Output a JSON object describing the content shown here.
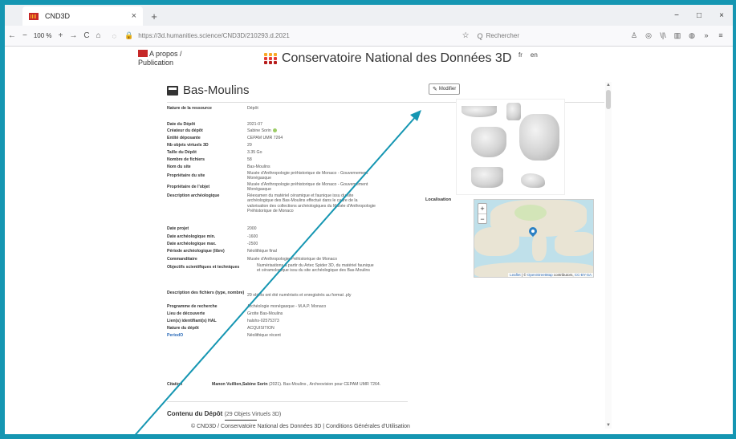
{
  "browser": {
    "tab_title": "CND3D",
    "tab_close": "×",
    "new_tab": "+",
    "window_controls": [
      "−",
      "□",
      "×"
    ],
    "back": "←",
    "forward": "→",
    "zoom_out": "−",
    "zoom_level": "100 %",
    "zoom_in": "+",
    "reload": "C",
    "home": "⌂",
    "shield": "◌",
    "lock": "🔒",
    "url": "https://3d.humanities.science/CND3D/210293.d.2021",
    "bookmark_star": "☆",
    "search_icon": "Q",
    "search_placeholder": "Rechercher",
    "toolbar_icons": [
      "♙",
      "◎",
      "\\|\\",
      "▥",
      "◍",
      "»",
      "≡"
    ]
  },
  "header": {
    "apropos": "A propos /",
    "publication": "Publication",
    "site_title": "Conservatoire National des Données 3D",
    "lang_fr": "fr",
    "lang_en": "en"
  },
  "document": {
    "title": "Bas-Moulins",
    "modifier_label": "Modifier",
    "fields": [
      {
        "label": "Nature de la ressource",
        "value": "Dépôt"
      },
      {
        "label": "Date du Dépôt",
        "value": "2021-07"
      },
      {
        "label": "Créateur du dépôt",
        "value": "Sabine Sorin"
      },
      {
        "label": "Entité déposante",
        "value": "CEPAM UMR 7264"
      },
      {
        "label": "Nb objets virtuels 3D",
        "value": "29"
      },
      {
        "label": "Taille du Dépôt",
        "value": "3.35 Go"
      },
      {
        "label": "Nombre de fichiers",
        "value": "58"
      },
      {
        "label": "Nom du site",
        "value": "Bas-Moulins"
      },
      {
        "label": "Propriétaire du site",
        "value": "Musée d'Anthropologie préhistorique de Monaco - Gouvernement Monégasque"
      },
      {
        "label": "Propriétaire de l'objet",
        "value": "Musée d'Anthropologie préhistorique de Monaco - Gouvernement Monégasque"
      },
      {
        "label": "Description archéologique",
        "value": "Réexamen du matériel céramique et faunique issu du site archéologique des Bas-Moulins effectué dans le cadre de la valorisation des collections archéologiques du Musée d'Anthropologie Préhistorique de Monaco"
      },
      {
        "label": "Date projet",
        "value": "2000"
      },
      {
        "label": "Date archéologique min.",
        "value": "-1600"
      },
      {
        "label": "Date archéologique max.",
        "value": "-2500"
      },
      {
        "label": "Période archéologique (libre)",
        "value": "Néolithique final"
      },
      {
        "label": "Commanditaire",
        "value": "Musée d'Anthropologie Préhistorique de Monaco"
      },
      {
        "label": "Objectifs scientifiques et techniques",
        "value": "Numérisations à partir du Artec Spider 3D, du matériel faunique et céramologique issu du site archéologique des Bas-Moulins"
      },
      {
        "label": "Description des fichiers (type, nombre)",
        "value": "29 objets ont été numérisés et enregistrés au format .ply"
      },
      {
        "label": "Programme de recherche",
        "value": "Archéologie monégasque - M.A.P. Monaco"
      },
      {
        "label": "Lieu de découverte",
        "value": "Grotte Bas-Moulins"
      },
      {
        "label": "Lien(s) identifiant(s) HAL",
        "value": "halshs-02575373"
      },
      {
        "label": "Nature du dépôt",
        "value": "ACQUISITION"
      },
      {
        "label": "PeriodO",
        "value": "Néolithique récent"
      }
    ],
    "localisation_label": "Localisation",
    "map_zoom_in": "+",
    "map_zoom_out": "−",
    "map_attrib_leaflet": "Leaflet",
    "map_attrib_sep": " | © ",
    "map_attrib_osm": "OpenStreetMap",
    "map_attrib_contrib": " contributors, ",
    "map_attrib_cc": "CC-BY-SA",
    "citation_label": "Citation",
    "citation_authors": "Manon Vuillien,Sabine Sorin",
    "citation_text": " (2021). Bas-Moulins , Archeovision pour CEPAM UMR 7264.",
    "contenu_title": "Contenu du Dépôt",
    "contenu_count": "(29 Objets Virtuels 3D)"
  },
  "footer": {
    "text": "© CND3D / Conservatoire National des Données 3D | Conditions Générales d'Utilisation"
  },
  "colors": {
    "frame": "#1596b2",
    "arrow": "#1596b2",
    "link": "#2a6ab8"
  }
}
